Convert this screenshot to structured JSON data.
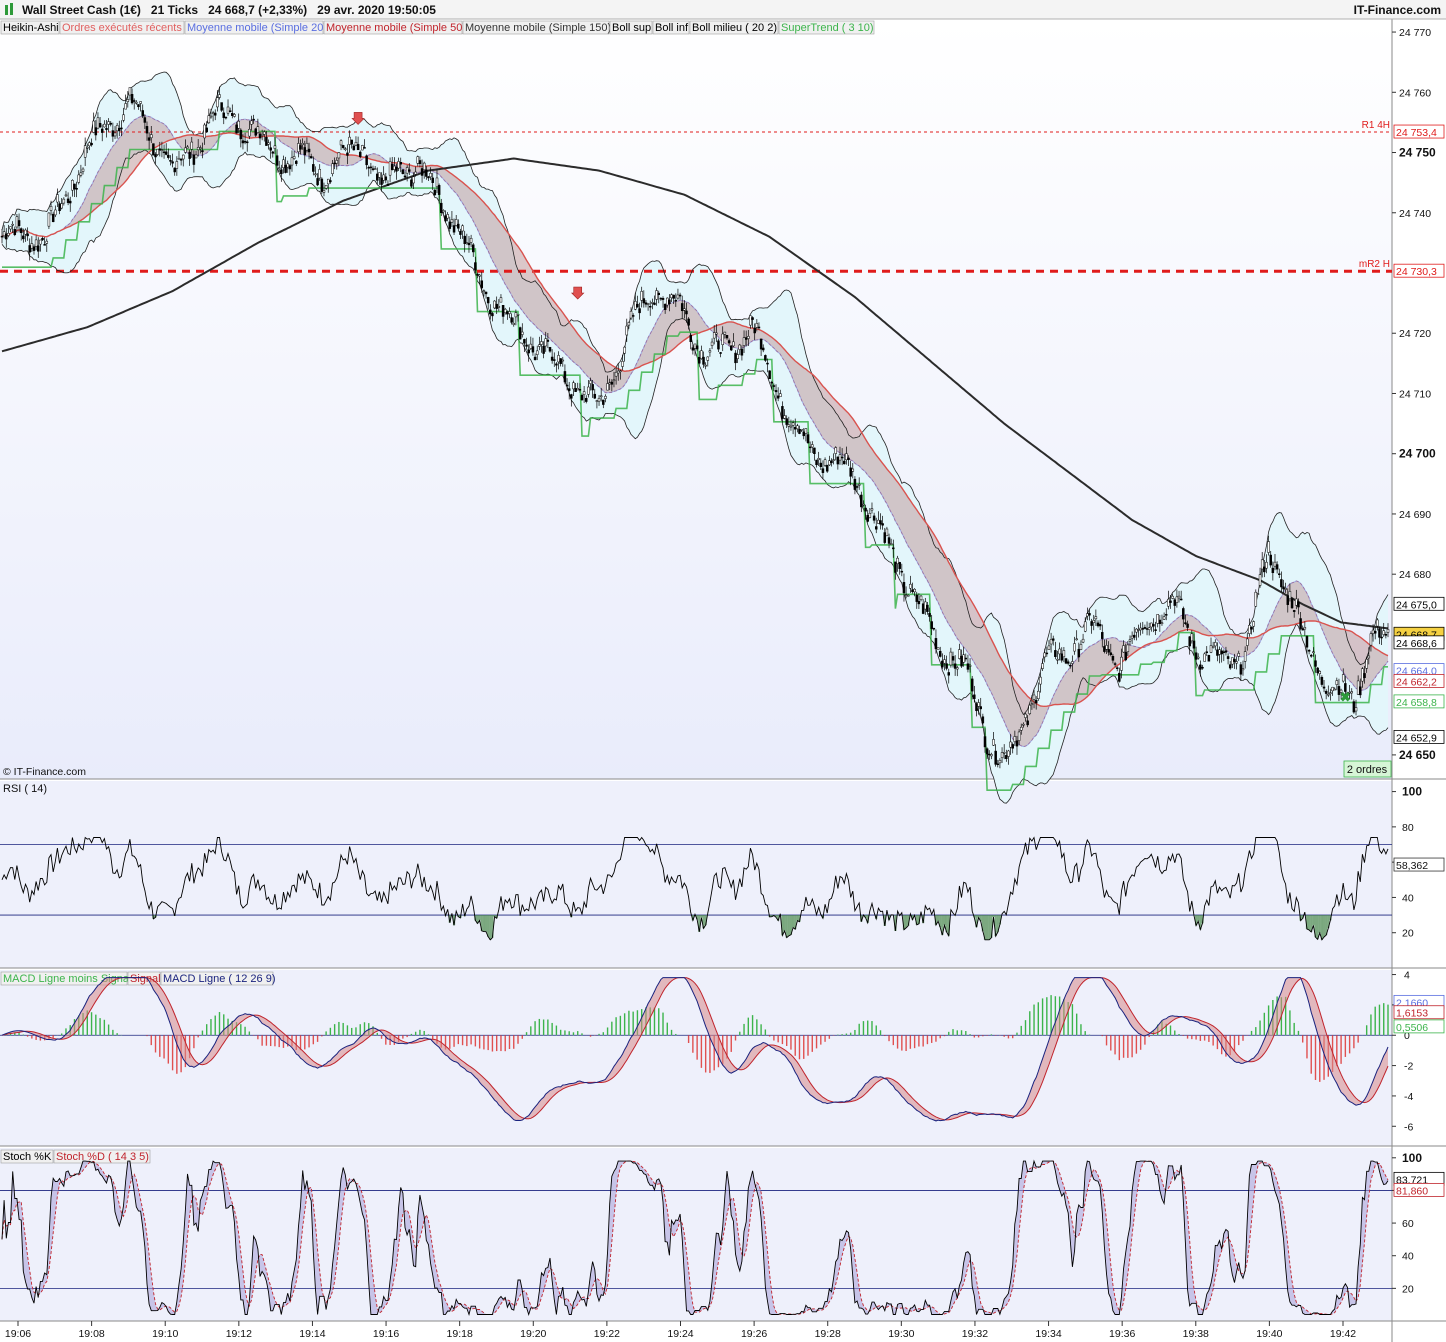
{
  "header": {
    "title": "Wall Street Cash (1€)",
    "ticks": "21 Ticks",
    "price": "24 668,7 (+2,33%)",
    "datetime": "29 avr. 2020 19:50:05",
    "brand": "IT-Finance.com"
  },
  "watermark": "© IT-Finance.com",
  "orders_badge": "2 ordres",
  "legend": [
    {
      "label": "Heikin-Ashi",
      "color": "#000000"
    },
    {
      "label": "Ordres exécutés récents",
      "color": "#e06060"
    },
    {
      "label": "Moyenne mobile (Simple 20)",
      "color": "#5a6ee0"
    },
    {
      "label": "Moyenne mobile (Simple 50)",
      "color": "#c0242c"
    },
    {
      "label": "Moyenne mobile (Simple 150)",
      "color": "#333333"
    },
    {
      "label": "Boll sup",
      "color": "#000000"
    },
    {
      "label": "Boll inf",
      "color": "#000000"
    },
    {
      "label": "Boll milieu ( 20 2)",
      "color": "#000000"
    },
    {
      "label": "SuperTrend ( 3 10)",
      "color": "#3cb44b"
    }
  ],
  "colors": {
    "bull": "#ffffff",
    "bear": "#000000",
    "sma20": "#7b8ee8",
    "sma50": "#d9534f",
    "sma150": "#2b2b2b",
    "supertrend": "#3cb44b",
    "pivot": "#e01b1b",
    "band_fill": "#e3f6fb",
    "cloud_red": "#b88a8a",
    "panel_bg": "#eef0fb"
  },
  "chart_data": [
    {
      "type": "candlestick",
      "name": "price",
      "ylim": [
        24646,
        24772
      ],
      "yticks": [
        {
          "value": 24770,
          "label": "24 770",
          "bold": false
        },
        {
          "value": 24760,
          "label": "24 760",
          "bold": false
        },
        {
          "value": 24750,
          "label": "24 750",
          "bold": true
        },
        {
          "value": 24740,
          "label": "24 740",
          "bold": false
        },
        {
          "value": 24720,
          "label": "24 720",
          "bold": false
        },
        {
          "value": 24710,
          "label": "24 710",
          "bold": false
        },
        {
          "value": 24700,
          "label": "24 700",
          "bold": true
        },
        {
          "value": 24690,
          "label": "24 690",
          "bold": false
        },
        {
          "value": 24680,
          "label": "24 680",
          "bold": false
        },
        {
          "value": 24650,
          "label": "24 650",
          "bold": true
        }
      ],
      "x_labels": [
        "19:06",
        "19:08",
        "19:10",
        "19:12",
        "19:14",
        "19:16",
        "19:18",
        "19:20",
        "19:22",
        "19:24",
        "19:26",
        "19:28",
        "19:30",
        "19:32",
        "19:34",
        "19:36",
        "19:38",
        "19:40",
        "19:42"
      ],
      "price_path": [
        [
          0,
          24736
        ],
        [
          20,
          24735
        ],
        [
          40,
          24752
        ],
        [
          60,
          24757
        ],
        [
          80,
          24748
        ],
        [
          100,
          24756
        ],
        [
          125,
          24752
        ],
        [
          140,
          24750
        ],
        [
          150,
          24746
        ],
        [
          160,
          24748
        ],
        [
          170,
          24751
        ],
        [
          178,
          24744
        ],
        [
          186,
          24749
        ],
        [
          195,
          24747
        ],
        [
          205,
          24742
        ],
        [
          215,
          24736
        ],
        [
          225,
          24730
        ],
        [
          240,
          24722
        ],
        [
          252,
          24716
        ],
        [
          268,
          24712
        ],
        [
          280,
          24709
        ],
        [
          292,
          24718
        ],
        [
          304,
          24726
        ],
        [
          318,
          24725
        ],
        [
          330,
          24718
        ],
        [
          342,
          24717
        ],
        [
          352,
          24720
        ],
        [
          362,
          24712
        ],
        [
          370,
          24707
        ],
        [
          380,
          24701
        ],
        [
          392,
          24698
        ],
        [
          402,
          24694
        ],
        [
          414,
          24686
        ],
        [
          426,
          24679
        ],
        [
          440,
          24667
        ],
        [
          452,
          24663
        ],
        [
          462,
          24654
        ],
        [
          470,
          24650
        ],
        [
          478,
          24655
        ],
        [
          488,
          24664
        ],
        [
          500,
          24666
        ],
        [
          512,
          24672
        ],
        [
          524,
          24666
        ],
        [
          536,
          24672
        ],
        [
          550,
          24674
        ],
        [
          562,
          24668
        ],
        [
          574,
          24666
        ],
        [
          584,
          24667
        ],
        [
          594,
          24683
        ],
        [
          604,
          24676
        ],
        [
          614,
          24668
        ],
        [
          624,
          24662
        ],
        [
          634,
          24658
        ],
        [
          642,
          24669
        ],
        [
          650,
          24668
        ]
      ],
      "sma150_path": [
        [
          0,
          24717
        ],
        [
          40,
          24721
        ],
        [
          80,
          24727
        ],
        [
          120,
          24735
        ],
        [
          160,
          24742
        ],
        [
          200,
          24747
        ],
        [
          240,
          24749
        ],
        [
          280,
          24747
        ],
        [
          320,
          24743
        ],
        [
          360,
          24736
        ],
        [
          400,
          24726
        ],
        [
          440,
          24714
        ],
        [
          470,
          24705
        ],
        [
          500,
          24697
        ],
        [
          530,
          24689
        ],
        [
          560,
          24683
        ],
        [
          590,
          24679
        ],
        [
          610,
          24675
        ],
        [
          628,
          24672
        ],
        [
          650,
          24671
        ]
      ],
      "r1_4h": {
        "value": 24753.4,
        "name": "R1 4H",
        "label": "24 753,4"
      },
      "mr2_h": {
        "value": 24730.3,
        "name": "mR2 H",
        "label": "24 730,3"
      },
      "price_tags": [
        {
          "value": 24675.0,
          "label": "24 675,0",
          "color": "#000000",
          "bg": "#ffffff"
        },
        {
          "value": 24668.7,
          "label": "24 668,7",
          "color": "#000000",
          "bg": "#f5d142"
        },
        {
          "value": 24668.6,
          "label": "24 668,6",
          "color": "#000000",
          "bg": "#ffffff"
        },
        {
          "value": 24664.0,
          "label": "24 664,0",
          "color": "#5a6ee0",
          "bg": "#ffffff"
        },
        {
          "value": 24662.2,
          "label": "24 662,2",
          "color": "#c0242c",
          "bg": "#ffffff"
        },
        {
          "value": 24658.8,
          "label": "24 658,8",
          "color": "#3cb44b",
          "bg": "#ffffff"
        },
        {
          "value": 24652.9,
          "label": "24 652,9",
          "color": "#000000",
          "bg": "#ffffff"
        }
      ]
    },
    {
      "type": "line",
      "name": "RSI ( 14)",
      "title": "RSI ( 14)",
      "ylim": [
        0,
        106
      ],
      "yticks": [
        100,
        80,
        60,
        40,
        20
      ],
      "levels": [
        70,
        30
      ],
      "current": {
        "value": 58.362,
        "label": "58,362"
      }
    },
    {
      "type": "macd",
      "title": "MACD Ligne moins Signal | Signal | MACD Ligne ( 12 26 9)",
      "series_labels": [
        "MACD Ligne moins Signal",
        "Signal",
        "MACD Ligne ( 12 26 9)"
      ],
      "ylim": [
        -7.3,
        4.3
      ],
      "yticks": [
        {
          "value": 4,
          "label": "4"
        },
        {
          "value": 2,
          "label": "2"
        },
        {
          "value": 0,
          "label": "0"
        },
        {
          "value": -2,
          "label": "-2"
        },
        {
          "value": -4,
          "label": "-4"
        },
        {
          "value": -6,
          "label": "-6"
        }
      ],
      "current": [
        {
          "value": 2.166,
          "label": "2,1660",
          "color": "#5a6ee0"
        },
        {
          "value": 1.6153,
          "label": "1,6153",
          "color": "#c0242c"
        },
        {
          "value": 0.5506,
          "label": "0,5506",
          "color": "#3cb44b"
        }
      ]
    },
    {
      "type": "line",
      "name": "Stoch %K",
      "title": "Stoch %K | Stoch %D ( 14 3 5)",
      "series_labels": [
        "Stoch %K",
        "Stoch %D ( 14 3 5)"
      ],
      "ylim": [
        0,
        106
      ],
      "yticks": [
        100,
        80,
        60,
        40,
        20
      ],
      "levels": [
        80,
        20
      ],
      "current": [
        {
          "value": 83.721,
          "label": "83,721",
          "color": "#000000"
        },
        {
          "value": 81.86,
          "label": "81,860",
          "color": "#c0242c"
        }
      ]
    }
  ]
}
